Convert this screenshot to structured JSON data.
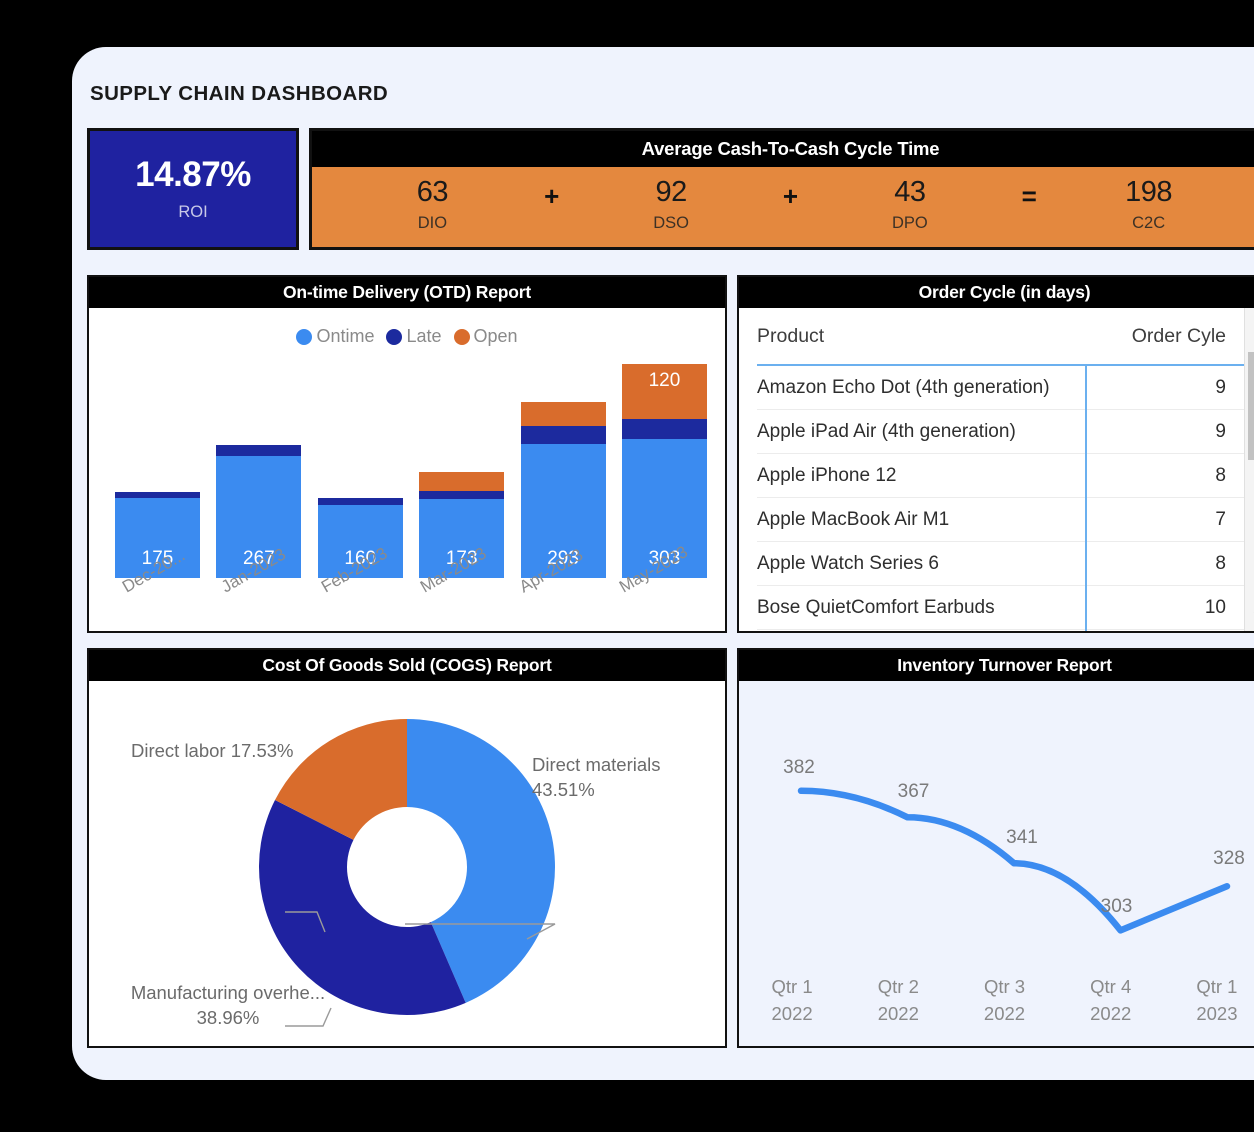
{
  "dashboard": {
    "title": "SUPPLY CHAIN DASHBOARD"
  },
  "kpis": {
    "roi": {
      "value": "14.87%",
      "label": "ROI",
      "color": "#1f22a0"
    },
    "c2c": {
      "title": "Average Cash-To-Cash Cycle Time",
      "color": "#e4883e",
      "terms": [
        {
          "value": "63",
          "label": "DIO"
        },
        {
          "value": "92",
          "label": "DSO"
        },
        {
          "value": "43",
          "label": "DPO"
        },
        {
          "value": "198",
          "label": "C2C"
        }
      ],
      "operators": [
        "+",
        "+",
        "="
      ]
    }
  },
  "panels": {
    "otd": {
      "title": "On-time Delivery (OTD) Report"
    },
    "order": {
      "title": "Order Cycle (in days)"
    },
    "cogs": {
      "title": "Cost Of Goods Sold (COGS) Report"
    },
    "inv": {
      "title": "Inventory Turnover Report"
    }
  },
  "order_table": {
    "columns": [
      "Product",
      "Order Cyle"
    ],
    "rows": [
      {
        "product": "Amazon Echo Dot (4th generation)",
        "cycle": "9"
      },
      {
        "product": "Apple iPad Air (4th generation)",
        "cycle": "9"
      },
      {
        "product": "Apple iPhone 12",
        "cycle": "8"
      },
      {
        "product": "Apple MacBook Air M1",
        "cycle": "7"
      },
      {
        "product": "Apple Watch Series 6",
        "cycle": "8"
      },
      {
        "product": "Bose QuietComfort Earbuds",
        "cycle": "10"
      }
    ],
    "scroll_up_icon": "chevron-up-icon",
    "scroll_down_icon": "chevron-down-icon"
  },
  "chart_data": [
    {
      "id": "otd",
      "type": "bar",
      "stacked": true,
      "title": "On-time Delivery (OTD) Report",
      "xlabel": "",
      "ylabel": "",
      "grid": false,
      "legend_position": "top",
      "categories": [
        "Dec-20...",
        "Jan-2023",
        "Feb-2023",
        "Mar-2023",
        "Apr-2023",
        "May-2023"
      ],
      "series": [
        {
          "name": "Ontime",
          "color": "#3b8bf0",
          "values": [
            175,
            267,
            160,
            173,
            293,
            303
          ]
        },
        {
          "name": "Late",
          "color": "#1c2a9e",
          "values": [
            14,
            23,
            16,
            18,
            40,
            45
          ]
        },
        {
          "name": "Open",
          "color": "#d96c2c",
          "values": [
            0,
            0,
            0,
            40,
            52,
            120
          ]
        }
      ],
      "visible_labels": {
        "Ontime": [
          "175",
          "267",
          "160",
          "173",
          "293",
          "303"
        ],
        "Open": [
          "",
          "",
          "",
          "",
          "",
          "120"
        ]
      },
      "ylim": [
        0,
        470
      ]
    },
    {
      "id": "cogs",
      "type": "pie",
      "donut": true,
      "title": "Cost Of Goods Sold (COGS) Report",
      "legend_position": "none",
      "labels": [
        "Direct materials",
        "Manufacturing overhe...",
        "Direct labor"
      ],
      "values": [
        43.51,
        38.96,
        17.53
      ],
      "value_labels": [
        "43.51%",
        "38.96%",
        "17.53%"
      ],
      "colors": [
        "#3b8bf0",
        "#1f22a0",
        "#d96c2c"
      ]
    },
    {
      "id": "inventory",
      "type": "line",
      "title": "Inventory Turnover Report",
      "xlabel": "",
      "ylabel": "",
      "grid": false,
      "legend_position": "none",
      "categories": [
        "Qtr 1\n2022",
        "Qtr 2\n2022",
        "Qtr 3\n2022",
        "Qtr 4\n2022",
        "Qtr 1\n2023"
      ],
      "x_tick_lines": [
        [
          "Qtr 1",
          "2022"
        ],
        [
          "Qtr 2",
          "2022"
        ],
        [
          "Qtr 3",
          "2022"
        ],
        [
          "Qtr 4",
          "2022"
        ],
        [
          "Qtr 1",
          "2023"
        ]
      ],
      "values": [
        382,
        367,
        341,
        303,
        328
      ],
      "data_labels": [
        "382",
        "367",
        "341",
        "303",
        "328"
      ],
      "color": "#3b8bf0",
      "ylim": [
        280,
        400
      ]
    }
  ],
  "cogs_labels": [
    {
      "name": "Direct materials",
      "pct": "43.51%"
    },
    {
      "name": "Direct labor",
      "pct": "17.53%"
    },
    {
      "name": "Manufacturing overhe...",
      "pct": "38.96%"
    }
  ]
}
